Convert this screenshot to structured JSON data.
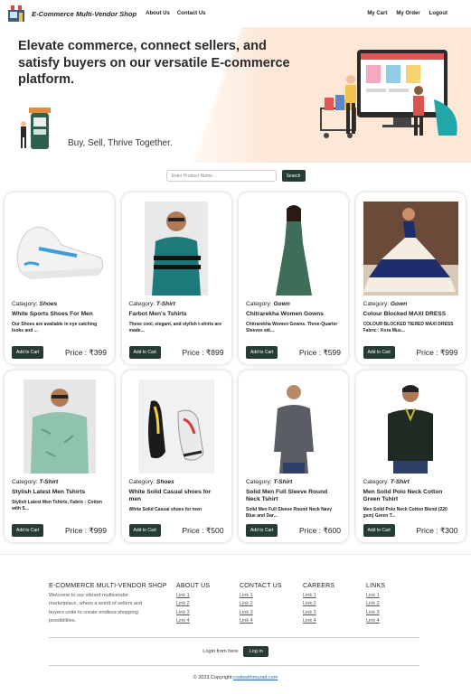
{
  "nav": {
    "brand": "E-Commerce Multi-Vendor Shop",
    "left_links": [
      "About Us",
      "Contact Us"
    ],
    "right_links": [
      "My Cart",
      "My Order",
      "Logout"
    ]
  },
  "hero": {
    "title": "Elevate commerce, connect sellers, and satisfy buyers on our versatile E-commerce platform.",
    "subtitle": "Buy, Sell, Thrive Together."
  },
  "search": {
    "placeholder": "Enter Product Name...",
    "button": "Search"
  },
  "products": [
    {
      "category_label": "Category: ",
      "category": "Shoes",
      "name": "White Sports Shoes For Men",
      "desc": "Our Shoes are available in eye catching looks and ...",
      "add": "Add to Cart",
      "price": "Price : ₹399",
      "img": "shoe-white"
    },
    {
      "category_label": "Category: ",
      "category": "T-Shirt",
      "name": "Farbot Men's Tshirts",
      "desc": "These cool, elegant, and stylish t-shirts are made...",
      "add": "Add to Cart",
      "price": "Price : ₹899",
      "img": "tshirt-teal"
    },
    {
      "category_label": "Category: ",
      "category": "Gown",
      "name": "Chitrarekha Women Gowns",
      "desc": "Chitrarekha Women Gowns. Three-Quarter Sleeves wit...",
      "add": "Add to Cart",
      "price": "Price : ₹599",
      "img": "gown-green"
    },
    {
      "category_label": "Category: ",
      "category": "Gown",
      "name": "Colour Blocked MAXI DRESS",
      "desc": "COLOUR BLOCKED TIERED MAXI DRESS Fabric : Kora Mus...",
      "add": "Add to Cart",
      "price": "Price : ₹999",
      "img": "gown-blue"
    },
    {
      "category_label": "Category: ",
      "category": "T-Shirt",
      "name": "Stylish Latest Men Tshirts",
      "desc": "Stylish Latest Men Tshirts, Fabric : Cotton with S...",
      "add": "Add to Cart",
      "price": "Price : ₹999",
      "img": "tshirt-mint"
    },
    {
      "category_label": "Category: ",
      "category": "Shoes",
      "name": "White Solid Casual shoes for men",
      "desc": "White Solid Casual shoes for men",
      "add": "Add to Cart",
      "price": "Price : ₹500",
      "img": "shoe-casual"
    },
    {
      "category_label": "Category: ",
      "category": "T-Shirt",
      "name": "Solid Men Full Sleeve Round Neck Tshirt",
      "desc": "Solid Men Full Sleeve Round Neck Navy Blue and Dar...",
      "add": "Add to Cart",
      "price": "Price : ₹600",
      "img": "tshirt-grey"
    },
    {
      "category_label": "Category: ",
      "category": "T-Shirt",
      "name": "Men Solid Polo Neck Cotton Green Tshirt",
      "desc": "Men Solid Polo Neck Cotton Blend (220 gsm) Green T...",
      "add": "Add to Cart",
      "price": "Price : ₹300",
      "img": "tshirt-darkgreen"
    }
  ],
  "footer": {
    "about_title": "E-COMMERCE MULTI-VENDOR SHOP",
    "about_text": "Welcome to our vibrant multivendor marketplace, where a world of sellers and buyers unite to create endless shopping possibilities.",
    "columns": [
      {
        "title": "ABOUT US",
        "links": [
          "Link 1",
          "Link 2",
          "Link 3",
          "Link 4"
        ]
      },
      {
        "title": "CONTACT US",
        "links": [
          "Link 1",
          "Link 2",
          "Link 3",
          "Link 4"
        ]
      },
      {
        "title": "CAREERS",
        "links": [
          "Link 1",
          "Link 2",
          "Link 3",
          "Link 4"
        ]
      },
      {
        "title": "LINKS",
        "links": [
          "Link 1",
          "Link 2",
          "Link 3",
          "Link 4"
        ]
      }
    ],
    "login_text": "Login from here",
    "login_button": "Log in",
    "copyright_prefix": "© 2023 Copyright:",
    "copyright_link": "codewithmurad.com"
  },
  "colors": {
    "accent": "#263b34",
    "hero_bg": "#fde7d7",
    "link": "#2a6ab1"
  }
}
